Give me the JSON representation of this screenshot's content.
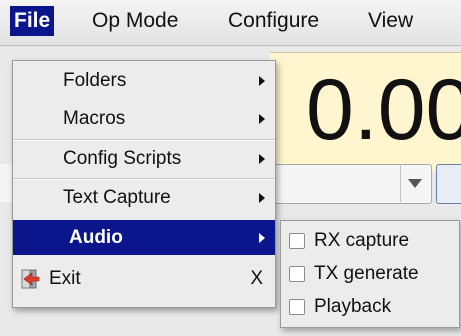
{
  "menubar": {
    "items": [
      {
        "label": "File"
      },
      {
        "label": "Op Mode"
      },
      {
        "label": "Configure"
      },
      {
        "label": "View"
      }
    ]
  },
  "background": {
    "frequency_text": "0.00"
  },
  "file_menu": {
    "items": [
      {
        "label": "Folders"
      },
      {
        "label": "Macros"
      },
      {
        "label": "Config Scripts"
      },
      {
        "label": "Text Capture"
      },
      {
        "label": "Audio"
      },
      {
        "label": "Exit",
        "accelerator": "X"
      }
    ]
  },
  "audio_submenu": {
    "items": [
      {
        "label": "RX capture",
        "checked": false
      },
      {
        "label": "TX generate",
        "checked": false
      },
      {
        "label": "Playback",
        "checked": false
      }
    ]
  },
  "colors": {
    "selection": "#0b168c",
    "frequency_panel": "#fff6cf"
  }
}
